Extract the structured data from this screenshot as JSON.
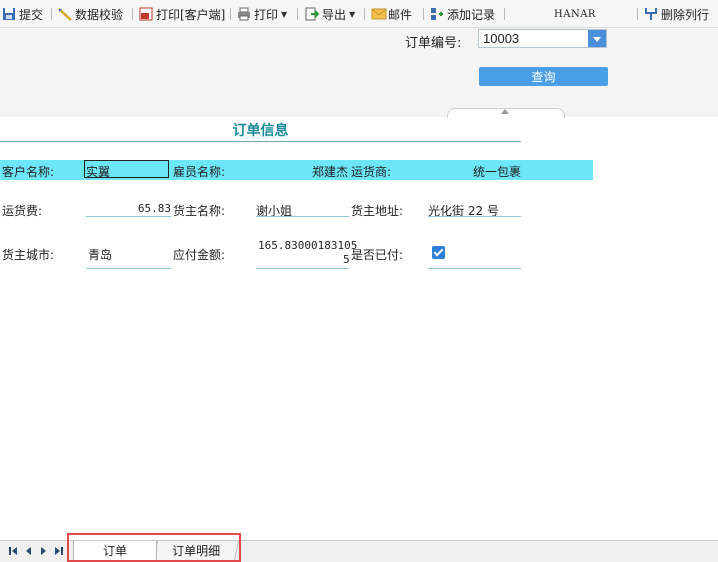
{
  "toolbar": {
    "submit": "提交",
    "data_validate": "数据校验",
    "print_client": "打印[客户端]",
    "print": "打印",
    "export": "导出",
    "mail": "邮件",
    "add_record": "添加记录",
    "center_text": "HANAR",
    "delete_row": "删除列行",
    "icons": [
      "save-icon",
      "validate-icon",
      "pdf-print-icon",
      "printer-icon",
      "export-icon",
      "mail-icon",
      "add-record-icon",
      "delete-row-icon"
    ]
  },
  "params": {
    "order_no_label": "订单编号:",
    "order_no_value": "10003",
    "query_label": "查询"
  },
  "report": {
    "title": "订单信息",
    "row1": {
      "customer_label": "客户名称:",
      "customer_value": "实翼",
      "employee_label": "雇员名称:",
      "employee_value": "郑建杰",
      "carrier_label": "运货商:",
      "carrier_value": "统一包裹"
    },
    "row2": {
      "freight_label": "运货费:",
      "freight_value": "65.83",
      "shipper_label": "货主名称:",
      "shipper_value": "谢小姐",
      "address_label": "货主地址:",
      "address_value": "光化街 22 号"
    },
    "row3": {
      "city_label": "货主城市:",
      "city_value": "青岛",
      "amount_label": "应付金额:",
      "amount_line1": "165.83000183105",
      "amount_line2": "5",
      "paid_label": "是否已付:",
      "paid_checked": true
    }
  },
  "sheets": {
    "tabs": [
      "订单",
      "订单明细"
    ],
    "active_index": 0
  },
  "colors": {
    "accent": "#4a9fe6",
    "highlight_row": "#6de7f7",
    "title_color": "#1a8a96",
    "tab_highlight": "#e04a4a"
  }
}
